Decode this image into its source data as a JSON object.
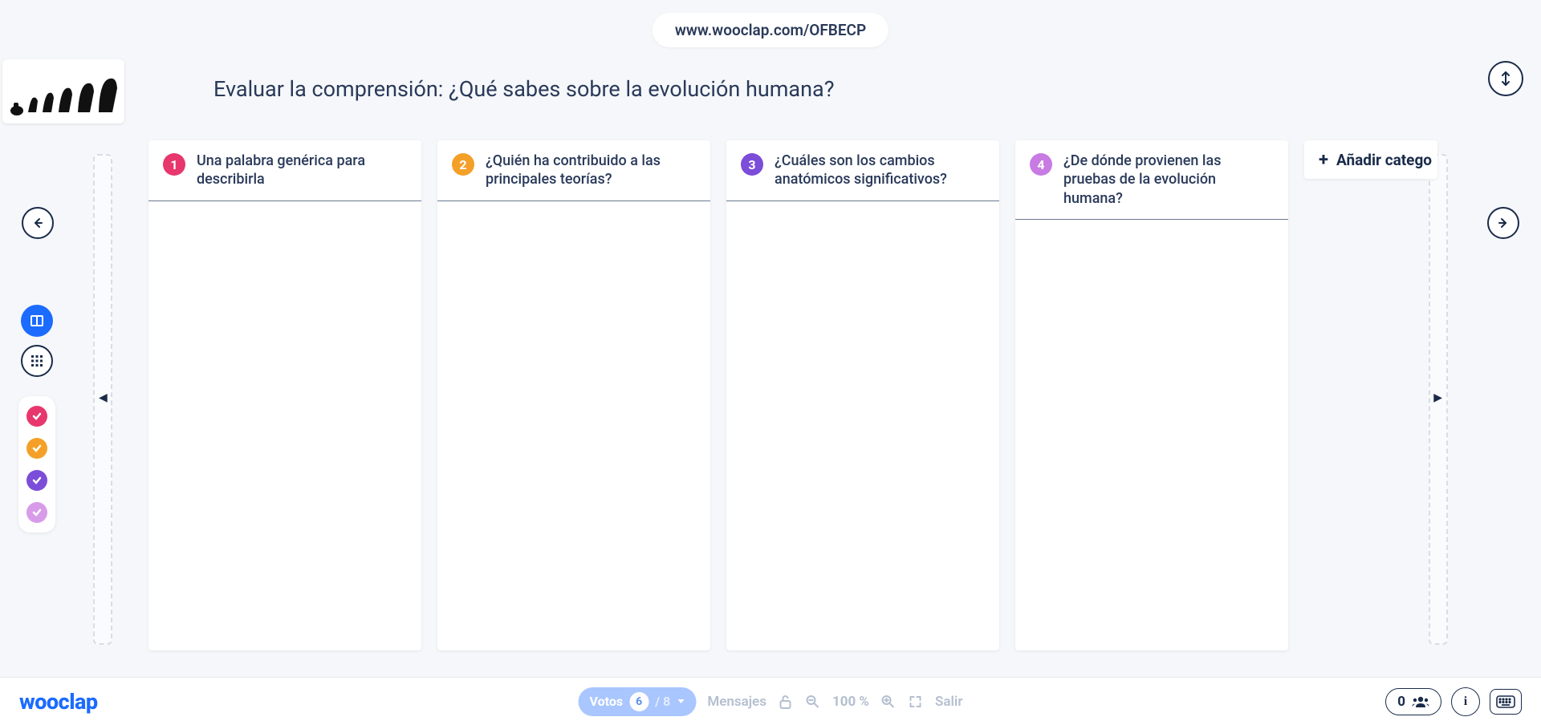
{
  "url_display": "www.wooclap.com/OFBECP",
  "question_title": "Evaluar la comprensión: ¿Qué sabes sobre la evolución humana?",
  "columns": [
    {
      "num": "1",
      "color": "c1",
      "title": "Una palabra genérica para describirla"
    },
    {
      "num": "2",
      "color": "c2",
      "title": "¿Quién ha contribuido a las principales teorías?"
    },
    {
      "num": "3",
      "color": "c3",
      "title": "¿Cuáles son los cambios anatómicos significativos?"
    },
    {
      "num": "4",
      "color": "c4",
      "title": "¿De dónde provienen las pruebas de la evolución humana?"
    }
  ],
  "add_category_label": "Añadir catego",
  "legend_colors": [
    "#e7376d",
    "#f4a028",
    "#7b4dd9",
    "#d89be9"
  ],
  "bottom": {
    "brand": "wooclap",
    "votes_label": "Votos",
    "votes_count": "6",
    "votes_total": "/ 8",
    "messages_label": "Mensajes",
    "zoom_label": "100 %",
    "exit_label": "Salir",
    "participants_count": "0"
  }
}
